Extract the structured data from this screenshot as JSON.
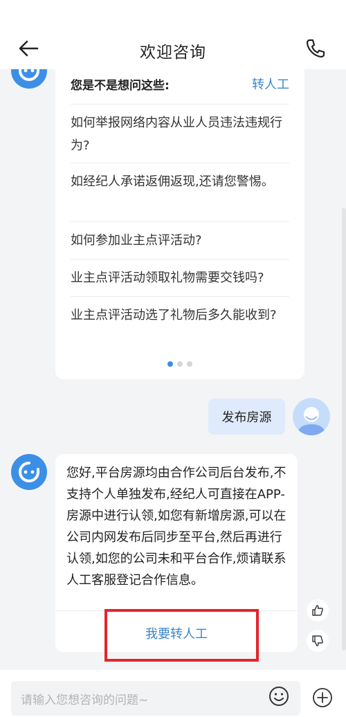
{
  "header": {
    "title": "欢迎咨询",
    "back_icon": "arrow-left-icon",
    "phone_icon": "phone-icon"
  },
  "suggestions": {
    "title": "您是不是想问这些:",
    "transfer_label": "转人工",
    "questions": [
      "如何举报网络内容从业人员违法违规行为?",
      "如经纪人承诺返佣返现,还请您警惕。",
      "如何参加业主点评活动?",
      "业主点评活动领取礼物需要交钱吗?",
      "业主点评活动选了礼物后多久能收到?"
    ]
  },
  "user_message": "发布房源",
  "bot_answer": {
    "text": "您好,平台房源均由合作公司后台发布,不支持个人单独发布,经纪人可直接在APP-房源中进行认领,如您有新增房源,可以在公司内网发布后同步至平台,然后再进行认领,如您的公司未和平台合作,烦请联系人工客服登记合作信息。",
    "transfer_button": "我要转人工"
  },
  "input": {
    "placeholder": "请输入您想咨询的问题~"
  },
  "colors": {
    "accent": "#3c8fe6",
    "link": "#3a86c9",
    "highlight": "#e5232a",
    "user_bubble": "#dfeafc"
  }
}
